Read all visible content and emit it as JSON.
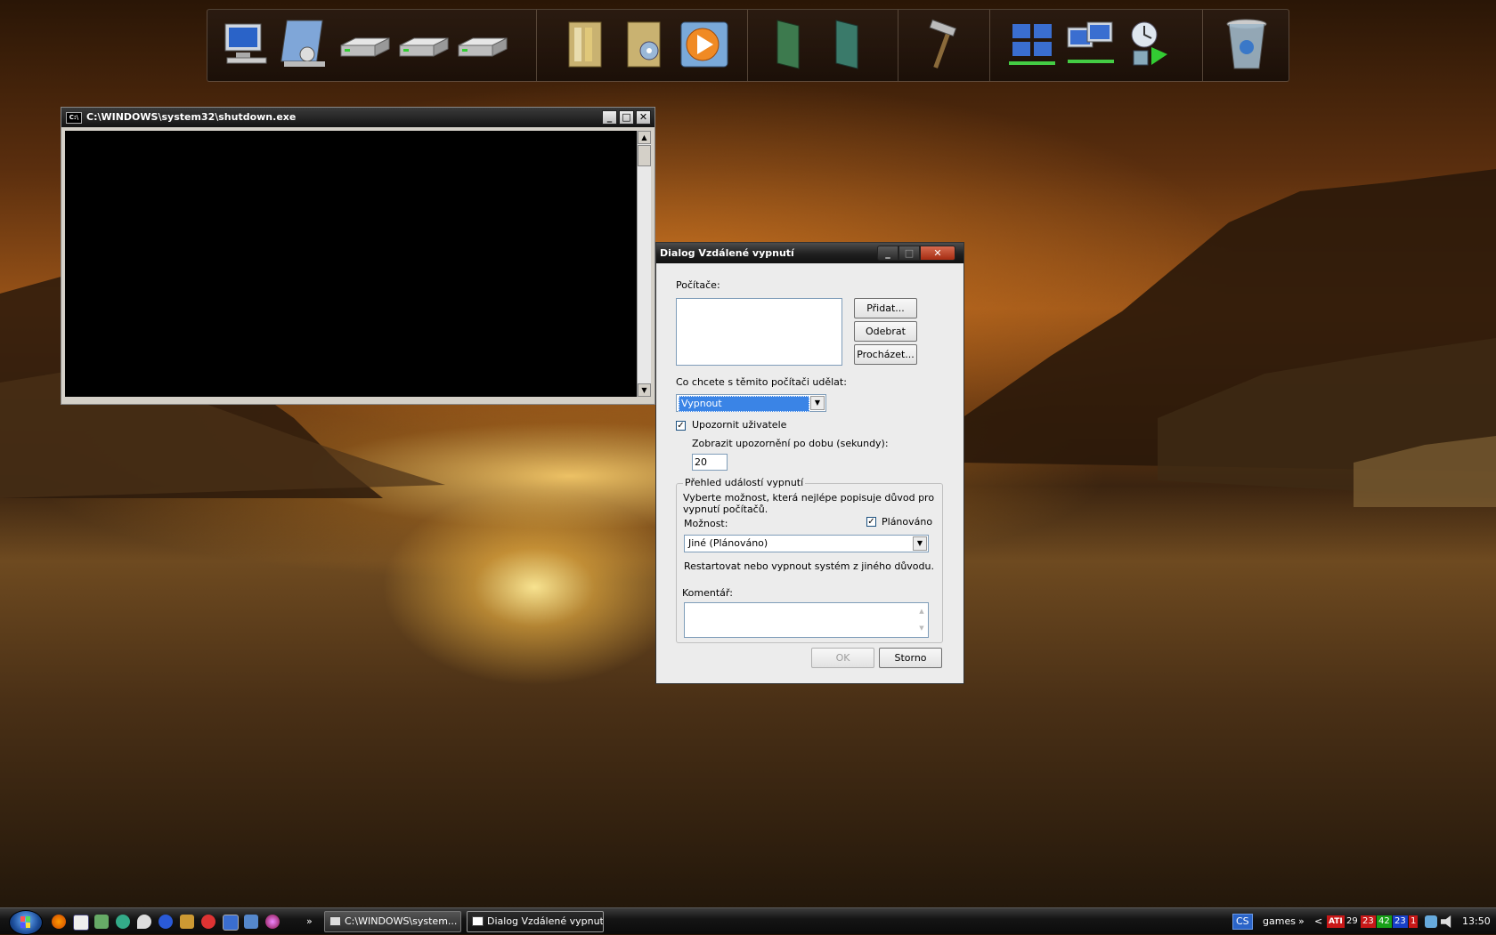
{
  "dock": {
    "icons": [
      "my-computer-icon",
      "control-panel-icon",
      "drive-c-icon",
      "drive-d-icon",
      "drive-e-icon",
      "documents-folder-icon",
      "music-folder-icon",
      "media-player-icon",
      "panel-green-icon",
      "panel-teal-icon",
      "hammer-tool-icon",
      "network-grid-icon",
      "network-places-icon",
      "sync-update-icon",
      "recycle-bin-icon"
    ]
  },
  "console": {
    "title": "C:\\WINDOWS\\system32\\shutdown.exe",
    "system_icon": "C:\\"
  },
  "dialog": {
    "title": "Dialog Vzdálené vypnutí",
    "computers_label": "Počítače:",
    "add_button": "Přidat...",
    "remove_button": "Odebrat",
    "browse_button": "Procházet...",
    "action_label": "Co chcete s těmito počítači udělat:",
    "action_value": "Vypnout",
    "notify_label": "Upozornit uživatele",
    "notify_checked": true,
    "timeout_label": "Zobrazit upozornění po dobu (sekundy):",
    "timeout_value": "20",
    "group_title": "Přehled událostí vypnutí",
    "group_desc": "Vyberte možnost, která nejlépe popisuje důvod pro vypnutí počítačů.",
    "option_label": "Možnost:",
    "planned_label": "Plánováno",
    "planned_checked": true,
    "option_value": "Jiné (Plánováno)",
    "option_desc": "Restartovat nebo vypnout systém z jiného důvodu.",
    "comment_label": "Komentář:",
    "ok_button": "OK",
    "cancel_button": "Storno"
  },
  "taskbar": {
    "tasks": [
      {
        "label": "C:\\WINDOWS\\system...",
        "active": false
      },
      {
        "label": "Dialog Vzdálené vypnutí",
        "active": true
      }
    ],
    "overflow": "»",
    "language": "CS",
    "toolbar_name": "games",
    "tray_overflow": "»",
    "tray_back": "<",
    "ati_label": "ATI",
    "temps": [
      "29",
      "23",
      "42",
      "23",
      "1"
    ],
    "clock": "13:50"
  },
  "colors": {
    "selection": "#3a84e6",
    "temp_colors": [
      "#1a1a1a",
      "#c81818",
      "#18a018",
      "#1840c8",
      "#c81818"
    ]
  }
}
